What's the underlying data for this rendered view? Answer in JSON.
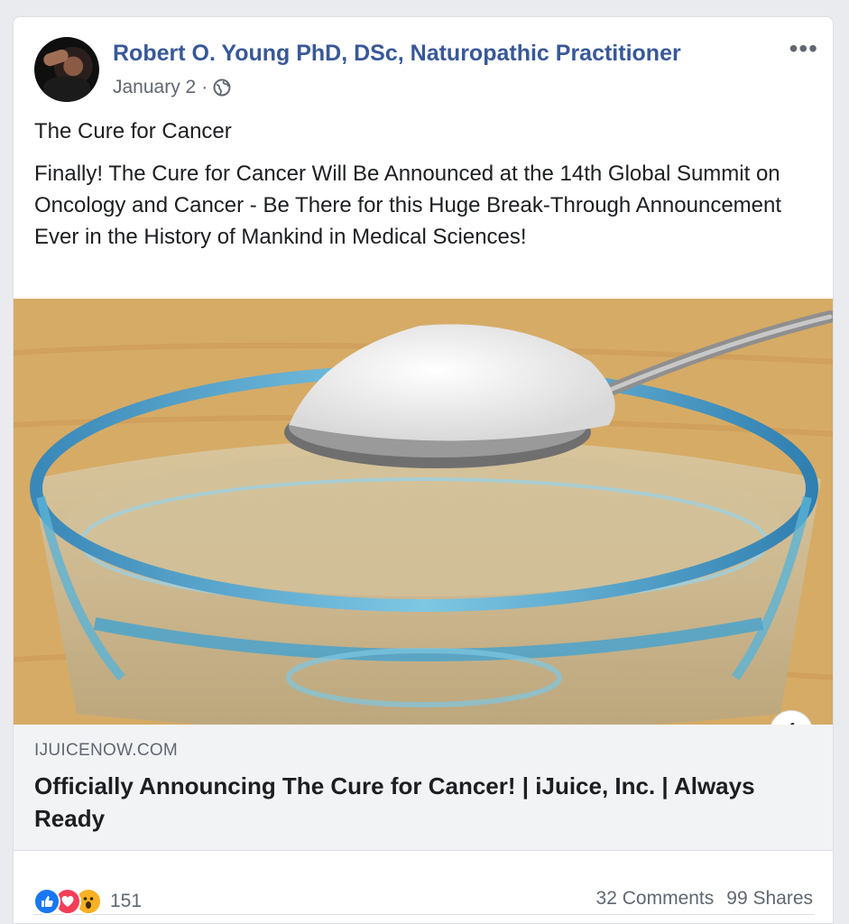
{
  "post": {
    "author": "Robert O. Young PhD, DSc, Naturopathic Practitioner",
    "date": "January 2",
    "date_separator": "·",
    "privacy_icon": "globe-icon",
    "more_icon": "more-options-icon",
    "title": "The Cure for Cancer",
    "body": "Finally! The Cure for Cancer Will Be Announced at the 14th Global Summit on Oncology and Cancer - Be There for this Huge Break-Through Announcement Ever in the History of Mankind in Medical Sciences!"
  },
  "link": {
    "domain": "IJUICENOW.COM",
    "title": "Officially Announcing The Cure for Cancer! | iJuice, Inc. | Always Ready",
    "info_label": "i"
  },
  "footer": {
    "reaction_icons": [
      "like-icon",
      "love-icon",
      "wow-icon"
    ],
    "reaction_count": "151",
    "comments": "32 Comments",
    "shares": "99 Shares"
  },
  "colors": {
    "author_link": "#385898",
    "secondary_text": "#606770",
    "like": "#1877f2",
    "love": "#f33e58",
    "wow": "#f7b125"
  }
}
